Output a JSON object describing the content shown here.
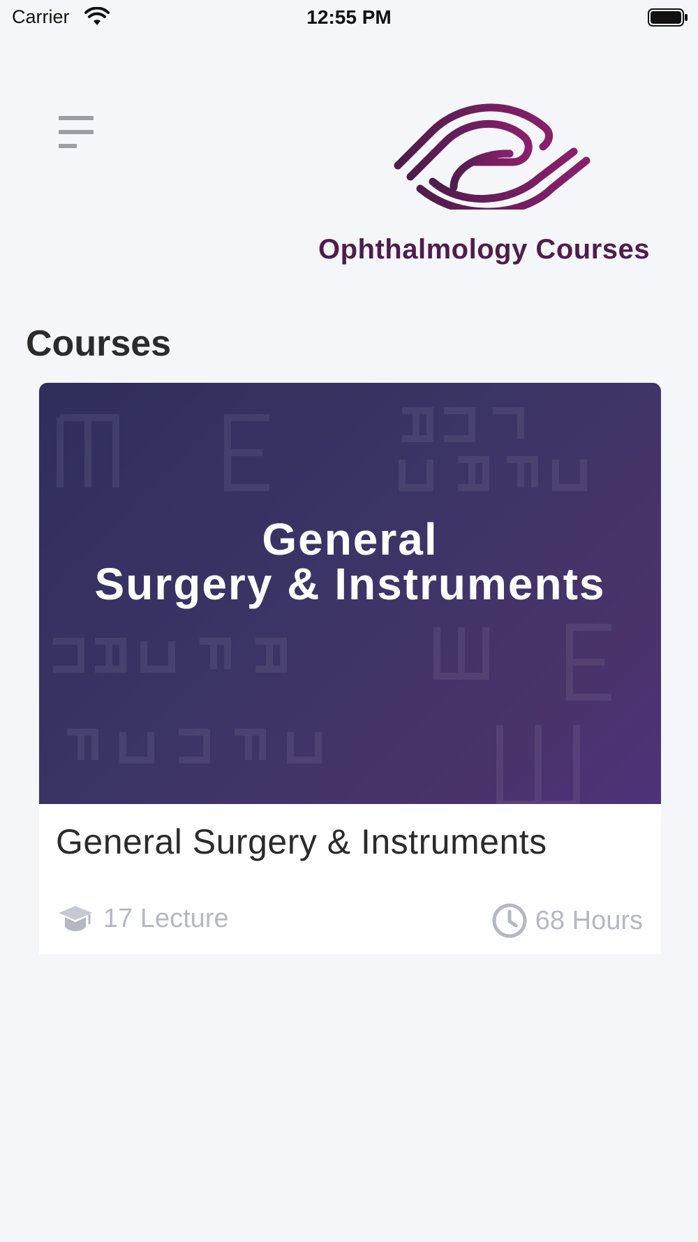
{
  "status_bar": {
    "carrier": "Carrier",
    "time": "12:55 PM",
    "wifi_icon": "wifi-icon",
    "battery_icon": "battery-icon"
  },
  "header": {
    "menu_icon": "hamburger-menu-icon",
    "logo_text": "Ophthalmology Courses",
    "logo_icon": "eye-logo-icon"
  },
  "colors": {
    "logo_primary": "#7a1e63",
    "logo_dark": "#4e1d4a",
    "banner_start": "#2f2e5c",
    "banner_end": "#4f327a",
    "meta_gray": "#b3b8c3",
    "background": "#f5f6fa"
  },
  "section": {
    "title": "Courses"
  },
  "courses": [
    {
      "banner_title_line1": "General",
      "banner_title_line2": "Surgery & Instruments",
      "name": "General Surgery & Instruments",
      "lectures": "17 Lecture",
      "hours": "68 Hours",
      "lectures_icon": "graduation-cap-icon",
      "hours_icon": "clock-icon"
    }
  ]
}
